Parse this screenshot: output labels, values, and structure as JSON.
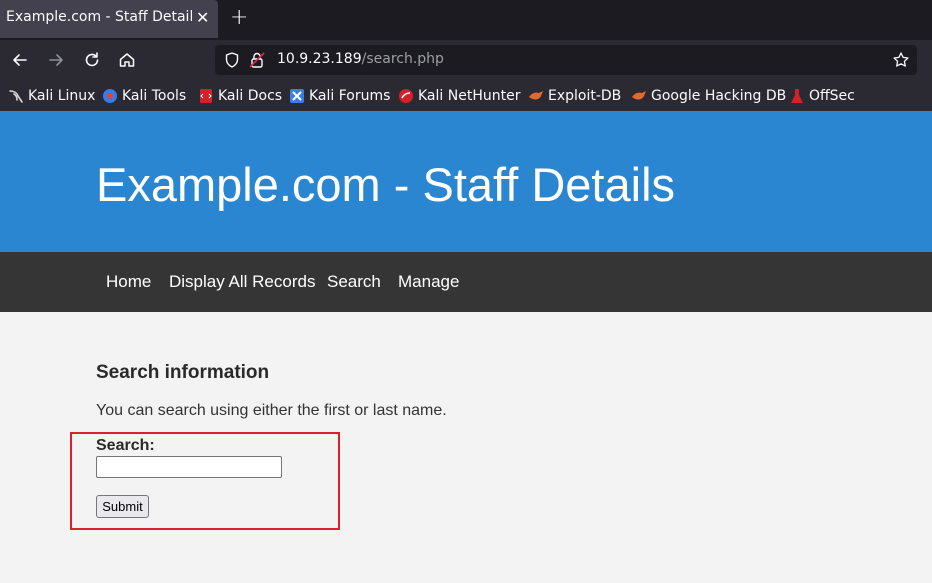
{
  "browser": {
    "tab_title": "Example.com - Staff Details -",
    "close_glyph": "✕",
    "newtab_glyph": "+",
    "url_host": "10.9.23.189",
    "url_path": "/search.php",
    "bookmarks": [
      {
        "label": "Kali Linux",
        "icon": "kali-dragon-icon"
      },
      {
        "label": "Kali Tools",
        "icon": "kali-tools-icon"
      },
      {
        "label": "Kali Docs",
        "icon": "kali-docs-icon"
      },
      {
        "label": "Kali Forums",
        "icon": "kali-forums-icon"
      },
      {
        "label": "Kali NetHunter",
        "icon": "kali-nethunter-icon"
      },
      {
        "label": "Exploit-DB",
        "icon": "exploit-db-icon"
      },
      {
        "label": "Google Hacking DB",
        "icon": "ghdb-icon"
      },
      {
        "label": "OffSec",
        "icon": "offsec-icon"
      }
    ]
  },
  "site": {
    "title": "Example.com - Staff Details",
    "nav": [
      "Home",
      "Display All Records",
      "Search",
      "Manage"
    ],
    "heading": "Search information",
    "description": "You can search using either the first or last name.",
    "search_label": "Search:",
    "search_value": "",
    "submit_label": "Submit"
  },
  "colors": {
    "header_bg": "#2b86d1",
    "nav_bg": "#353535",
    "highlight_border": "#d9222c"
  }
}
